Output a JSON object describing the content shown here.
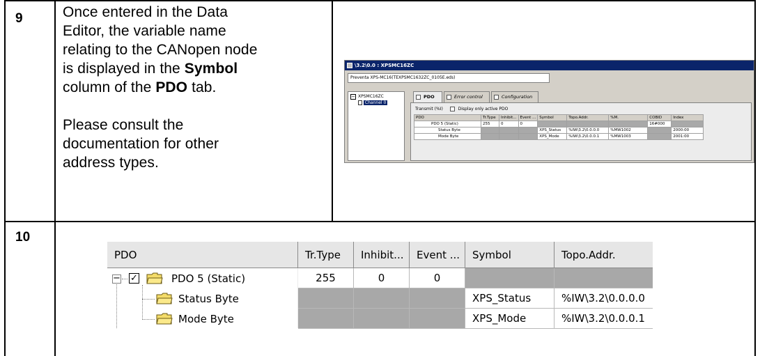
{
  "steps": [
    {
      "number": "9",
      "text_lines": [
        "Once entered in the Data",
        "Editor, the variable name",
        "relating to the CANopen node",
        "is displayed in the",
        "Symbol",
        "column of the",
        "PDO",
        "tab.",
        "Please consult the",
        "documentation for other",
        "address types."
      ]
    },
    {
      "number": "10"
    }
  ],
  "mini_screenshot": {
    "title": "\\3.2\\0.0 : XPSMC16ZC",
    "description": "Preventa XPS-MC16(TEXPSMC1632ZC_0105E.eds)",
    "tree": {
      "node": "XPSMC16ZC",
      "child": "Channel 0"
    },
    "tabs": [
      "PDO",
      "Error control",
      "Configuration"
    ],
    "filter_label": "Transmit (%I)",
    "filter_checkbox_label": "Display only active PDO",
    "columns": [
      "PDO",
      "Tr.Type",
      "Inhibit...",
      "Event ...",
      "Symbol",
      "Topo.Addr.",
      "%M.",
      "COBID",
      "Index"
    ],
    "rows": [
      [
        "PDO 5 (Static)",
        "255",
        "0",
        "0",
        "",
        "",
        "",
        "16#000",
        ""
      ],
      [
        "Status Byte",
        "",
        "",
        "",
        "XPS_Status",
        "%IW\\3.2\\0.0.0.0",
        "%MW1002",
        "",
        "2000:00"
      ],
      [
        "Mode Byte",
        "",
        "",
        "",
        "XPS_Mode",
        "%IW\\3.2\\0.0.0.1",
        "%MW1003",
        "",
        "2001:00"
      ]
    ]
  },
  "big_grid": {
    "columns": [
      "PDO",
      "Tr.Type",
      "Inhibit...",
      "Event ...",
      "Symbol",
      "Topo.Addr."
    ],
    "pdo_row": {
      "label": "PDO 5 (Static)",
      "expander": "−",
      "checked": "✓",
      "tr_type": "255",
      "inhibit": "0",
      "event": "0"
    },
    "items": [
      {
        "label": "Status Byte",
        "symbol": "XPS_Status",
        "topo": "%IW\\3.2\\0.0.0.0"
      },
      {
        "label": "Mode Byte",
        "symbol": "XPS_Mode",
        "topo": "%IW\\3.2\\0.0.0.1"
      }
    ]
  },
  "colors": {
    "title_bar": "#0a246a",
    "gray_cell": "#a8a8a8",
    "folder_yellow": "#f4dc6a"
  }
}
